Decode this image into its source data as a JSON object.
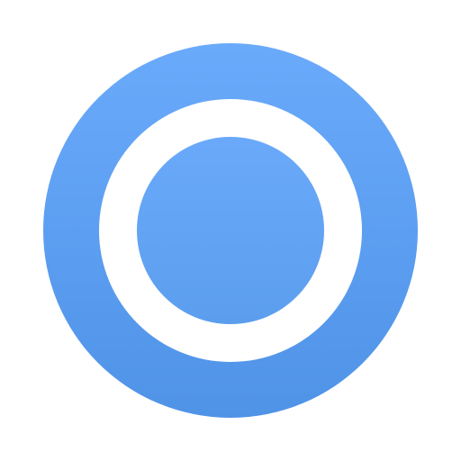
{
  "icon": {
    "name": "ring-icon",
    "colors": {
      "background": "#ffffff",
      "outer_gradient_top": "#6AAAFB",
      "outer_gradient_bottom": "#4F93E7",
      "ring": "#ffffff",
      "inner_gradient_top": "#6AA9FA",
      "inner_gradient_bottom": "#5C9EEE"
    }
  }
}
